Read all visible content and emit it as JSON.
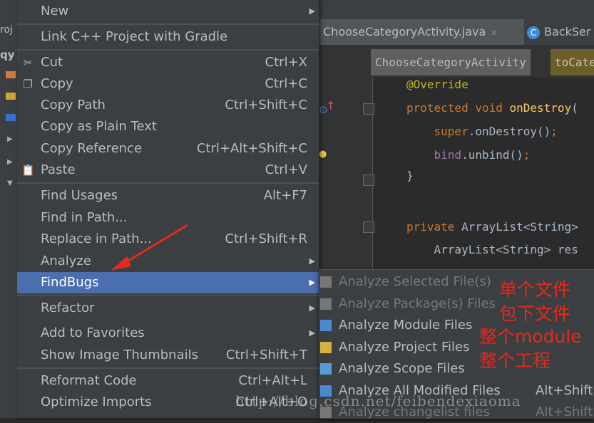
{
  "ide": {
    "project_label": "roj",
    "project_short": "qy"
  },
  "tabs": [
    {
      "label": "ChooseCategoryActivity.java",
      "close": "×",
      "active": true
    },
    {
      "label": "BackSer",
      "icon": "C",
      "active": false
    }
  ],
  "breadcrumbs": [
    "ChooseCategoryActivity",
    "toCate"
  ],
  "code_lines": [
    {
      "segments": [
        {
          "t": "@Override",
          "c": "#bbb529"
        }
      ]
    },
    {
      "segments": [
        {
          "t": "protected void ",
          "c": "#cc7832"
        },
        {
          "t": "onDestroy",
          "c": "#ffc66d"
        },
        {
          "t": "(",
          "c": "#a9b7c6"
        }
      ]
    },
    {
      "segments": [
        {
          "t": "    super",
          "c": "#cc7832"
        },
        {
          "t": ".onDestroy()",
          "c": "#a9b7c6"
        },
        {
          "t": ";",
          "c": "#cc7832"
        }
      ]
    },
    {
      "segments": [
        {
          "t": "    bind",
          "c": "#9876aa"
        },
        {
          "t": ".unbind()",
          "c": "#a9b7c6"
        },
        {
          "t": ";",
          "c": "#cc7832"
        }
      ]
    },
    {
      "segments": [
        {
          "t": "}",
          "c": "#a9b7c6"
        }
      ]
    },
    {
      "segments": [
        {
          "t": "",
          "c": "#a9b7c6"
        }
      ]
    },
    {
      "segments": [
        {
          "t": "private ",
          "c": "#cc7832"
        },
        {
          "t": "ArrayList<String>",
          "c": "#a9b7c6"
        }
      ]
    },
    {
      "segments": [
        {
          "t": "    ArrayList<String> res",
          "c": "#a9b7c6"
        }
      ]
    }
  ],
  "context_menu": {
    "items": [
      {
        "label": "New",
        "shortcut": "",
        "submenu": true,
        "icon": ""
      },
      {
        "label": "Link C++ Project with Gradle",
        "shortcut": "",
        "submenu": false,
        "icon": ""
      },
      {
        "label": "Cut",
        "shortcut": "Ctrl+X",
        "submenu": false,
        "icon": "scissors-icon"
      },
      {
        "label": "Copy",
        "shortcut": "Ctrl+C",
        "submenu": false,
        "icon": "copy-icon"
      },
      {
        "label": "Copy Path",
        "shortcut": "Ctrl+Shift+C",
        "submenu": false,
        "icon": ""
      },
      {
        "label": "Copy as Plain Text",
        "shortcut": "",
        "submenu": false,
        "icon": ""
      },
      {
        "label": "Copy Reference",
        "shortcut": "Ctrl+Alt+Shift+C",
        "submenu": false,
        "icon": ""
      },
      {
        "label": "Paste",
        "shortcut": "Ctrl+V",
        "submenu": false,
        "icon": "paste-icon"
      },
      {
        "label": "Find Usages",
        "shortcut": "Alt+F7",
        "submenu": false,
        "icon": ""
      },
      {
        "label": "Find in Path...",
        "shortcut": "",
        "submenu": false,
        "icon": ""
      },
      {
        "label": "Replace in Path...",
        "shortcut": "Ctrl+Shift+R",
        "submenu": false,
        "icon": ""
      },
      {
        "label": "Analyze",
        "shortcut": "",
        "submenu": true,
        "icon": ""
      },
      {
        "label": "FindBugs",
        "shortcut": "",
        "submenu": true,
        "icon": "",
        "selected": true
      },
      {
        "label": "Refactor",
        "shortcut": "",
        "submenu": true,
        "icon": ""
      },
      {
        "label": "Add to Favorites",
        "shortcut": "",
        "submenu": true,
        "icon": ""
      },
      {
        "label": "Show Image Thumbnails",
        "shortcut": "Ctrl+Shift+T",
        "submenu": false,
        "icon": ""
      },
      {
        "label": "Reformat Code",
        "shortcut": "Ctrl+Alt+L",
        "submenu": false,
        "icon": ""
      },
      {
        "label": "Optimize Imports",
        "shortcut": "Ctrl+Alt+O",
        "submenu": false,
        "icon": ""
      }
    ]
  },
  "findbugs_submenu": {
    "items": [
      {
        "label": "Analyze Selected File(s)",
        "shortcut": "",
        "disabled": true
      },
      {
        "label": "Analyze Package(s) Files",
        "shortcut": "",
        "disabled": true
      },
      {
        "label": "Analyze Module Files",
        "shortcut": "",
        "disabled": false
      },
      {
        "label": "Analyze Project Files",
        "shortcut": "",
        "disabled": false
      },
      {
        "label": "Analyze Scope Files",
        "shortcut": "",
        "disabled": false
      },
      {
        "label": "Analyze All Modified Files",
        "shortcut": "Alt+Shift+",
        "disabled": false
      },
      {
        "label": "Analyze changelist files",
        "shortcut": "Alt+Shift+",
        "disabled": true
      }
    ]
  },
  "annotations": [
    "单个文件",
    "包下文件",
    "整个module",
    "整个工程"
  ],
  "watermark": "http://blog.csdn.net/feibendexiaoma",
  "colors": {
    "annotation": "#e5291c",
    "selection": "#4b6eaf",
    "menu_bg": "#3c3f41"
  }
}
